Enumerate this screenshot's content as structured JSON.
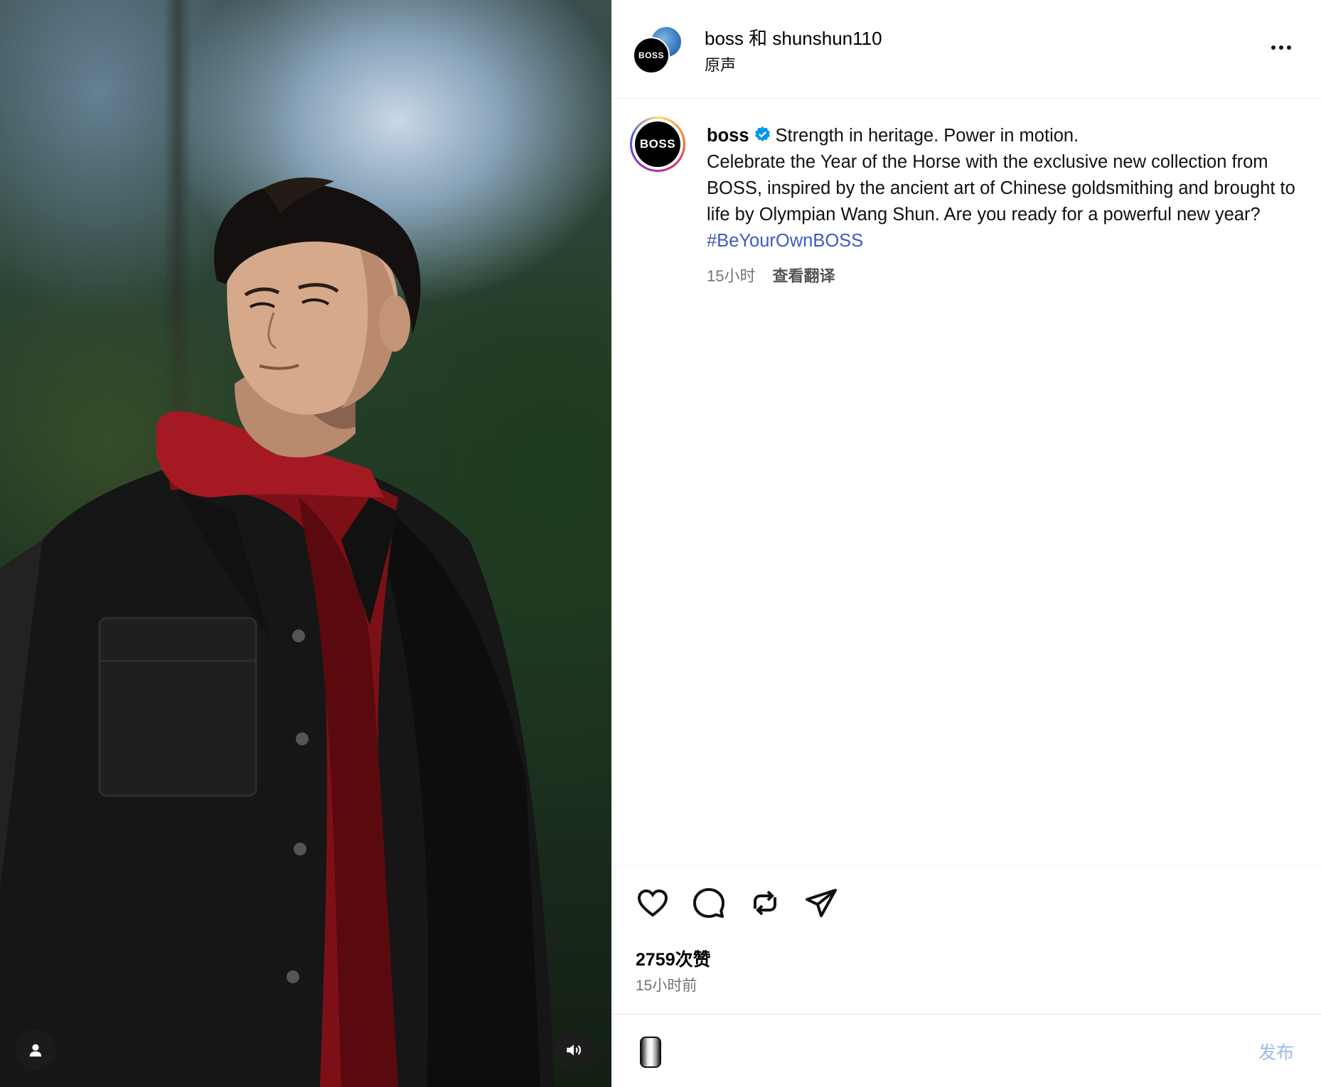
{
  "header": {
    "title": "boss 和 shunshun110",
    "subtitle": "原声",
    "avatar_text": "BOSS"
  },
  "caption": {
    "avatar_text": "BOSS",
    "username": "boss",
    "line1": "Strength in heritage. Power in motion.",
    "body": "Celebrate the Year of the Horse with the exclusive new collection from BOSS, inspired by the ancient art of Chinese goldsmithing and brought to life by Olympian Wang Shun. Are you ready for a powerful new year? ",
    "hashtag": "#BeYourOwnBOSS",
    "time": "15小时",
    "translate": "查看翻译"
  },
  "engagement": {
    "likes": "2759次赞",
    "time_ago": "15小时前"
  },
  "comment": {
    "placeholder": "",
    "post_label": "发布"
  },
  "icons": {
    "more": "more-horizontal-icon",
    "verified": "verified-badge-icon",
    "like": "heart-icon",
    "comment": "comment-bubble-icon",
    "repost": "repost-icon",
    "share": "send-icon",
    "user_tags": "user-icon",
    "sound": "speaker-icon",
    "emoji": "emoji-icon"
  },
  "colors": {
    "hashtag": "#3b5bbf",
    "verified": "#0095f6",
    "post_button": "#9bb9ea",
    "meta_text": "#737373"
  }
}
